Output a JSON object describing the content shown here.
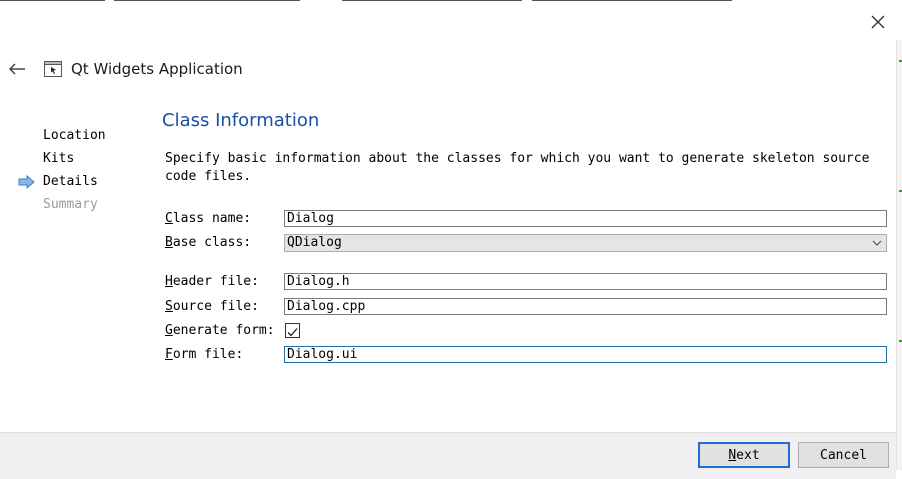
{
  "window": {
    "title": "Qt Widgets Application",
    "close_icon": "close-icon",
    "back_icon": "back-arrow-icon",
    "title_icon": "application-window-icon"
  },
  "steps": [
    {
      "label": "Location",
      "state": "done"
    },
    {
      "label": "Kits",
      "state": "done"
    },
    {
      "label": "Details",
      "state": "current"
    },
    {
      "label": "Summary",
      "state": "pending"
    }
  ],
  "page": {
    "title": "Class Information",
    "description_line1": "Specify basic information about the classes for which you want to generate skeleton source",
    "description_line2": "code files."
  },
  "form": {
    "class_name": {
      "label_mnemonic": "C",
      "label_rest": "lass name:",
      "value": "Dialog"
    },
    "base_class": {
      "label_mnemonic": "B",
      "label_rest": "ase class:",
      "value": "QDialog"
    },
    "header_file": {
      "label_mnemonic": "H",
      "label_rest": "eader file:",
      "value": "Dialog.h"
    },
    "source_file": {
      "label_mnemonic": "S",
      "label_rest": "ource file:",
      "value": "Dialog.cpp"
    },
    "generate_form": {
      "label_mnemonic": "G",
      "label_rest": "enerate form:",
      "checked": true
    },
    "form_file": {
      "label_mnemonic": "F",
      "label_rest": "orm file:",
      "value": "Dialog.ui"
    }
  },
  "buttons": {
    "next_mnemonic": "N",
    "next_rest": "ext",
    "cancel": "Cancel"
  },
  "colors": {
    "accent": "#1a4fa8",
    "focus_border": "#1c6fd0",
    "footer_bg": "#f0f0f0",
    "arrow": "#4a90d9"
  }
}
